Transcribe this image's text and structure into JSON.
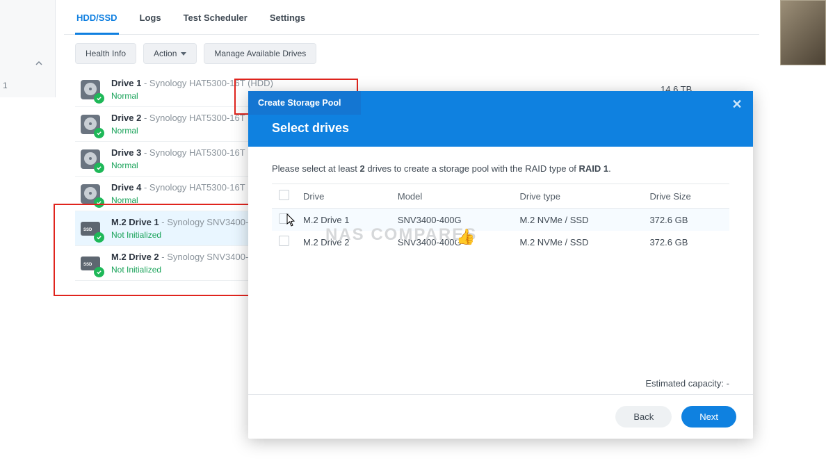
{
  "sidebar": {
    "count_fragment": "1"
  },
  "tabs": {
    "hdd": "HDD/SSD",
    "logs": "Logs",
    "scheduler": "Test Scheduler",
    "settings": "Settings"
  },
  "toolbar": {
    "health": "Health Info",
    "action": "Action",
    "manage": "Manage Available Drives"
  },
  "drives": [
    {
      "name": "Drive 1",
      "desc": " - Synology HAT5300-16T (HDD)",
      "status": "Normal",
      "cap": "14.6 TB",
      "kind": "hdd"
    },
    {
      "name": "Drive 2",
      "desc": " - Synology HAT5300-16T",
      "status": "Normal",
      "cap": "",
      "kind": "hdd"
    },
    {
      "name": "Drive 3",
      "desc": " - Synology HAT5300-16T",
      "status": "Normal",
      "cap": "",
      "kind": "hdd"
    },
    {
      "name": "Drive 4",
      "desc": " - Synology HAT5300-16T (",
      "status": "Normal",
      "cap": "",
      "kind": "hdd"
    },
    {
      "name": "M.2 Drive 1",
      "desc": " - Synology SNV3400-",
      "status": "Not Initialized",
      "cap": "",
      "kind": "ssd",
      "selected": true
    },
    {
      "name": "M.2 Drive 2",
      "desc": " - Synology SNV3400-",
      "status": "Not Initialized",
      "cap": "",
      "kind": "ssd"
    }
  ],
  "dialog": {
    "title": "Create Storage Pool",
    "heading": "Select drives",
    "prompt_pre": "Please select at least ",
    "prompt_num": "2",
    "prompt_mid": " drives to create a storage pool with the RAID type of ",
    "prompt_raid": "RAID 1",
    "prompt_post": ".",
    "cols": {
      "drive": "Drive",
      "model": "Model",
      "type": "Drive type",
      "size": "Drive Size"
    },
    "rows": [
      {
        "drive": "M.2 Drive 1",
        "model": "SNV3400-400G",
        "type": "M.2 NVMe / SSD",
        "size": "372.6 GB"
      },
      {
        "drive": "M.2 Drive 2",
        "model": "SNV3400-400G",
        "type": "M.2 NVMe / SSD",
        "size": "372.6 GB"
      }
    ],
    "est_label": "Estimated capacity: ",
    "est_value": "-",
    "back": "Back",
    "next": "Next"
  },
  "watermark": "NAS COMPARES"
}
